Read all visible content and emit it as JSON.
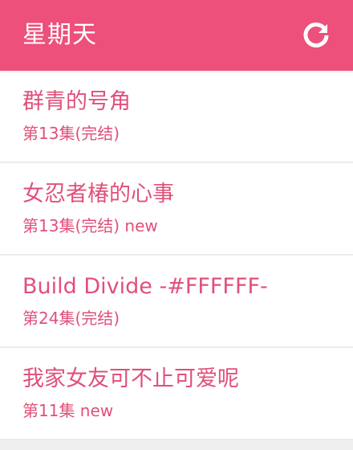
{
  "header": {
    "title": "星期天",
    "refresh_icon": "refresh-icon",
    "background": "#ec507b"
  },
  "items": [
    {
      "title": "群青的号角",
      "subtitle": "第13集(完结)"
    },
    {
      "title": "女忍者椿的心事",
      "subtitle": "第13集(完结) new"
    },
    {
      "title": "Build Divide -#FFFFFF-",
      "subtitle": "第24集(完结)"
    },
    {
      "title": "我家女友可不止可爱呢",
      "subtitle": "第11集 new"
    }
  ],
  "colors": {
    "accent": "#e0507a",
    "list_background": "#ffffff",
    "divider": "#ececec"
  }
}
